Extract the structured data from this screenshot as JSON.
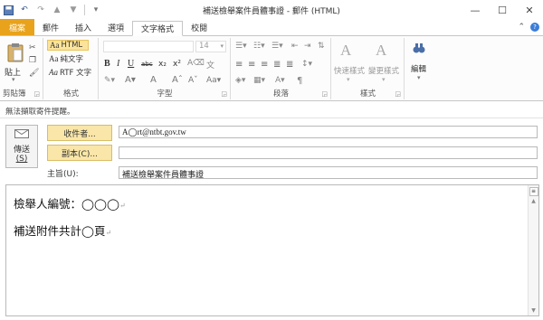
{
  "window": {
    "title": "補送檢舉案件員體事證 - 郵件 (HTML)"
  },
  "tabs": [
    {
      "label": "檔案"
    },
    {
      "label": "郵件"
    },
    {
      "label": "插入"
    },
    {
      "label": "選項"
    },
    {
      "label": "文字格式"
    },
    {
      "label": "校閱"
    }
  ],
  "ribbon": {
    "clipboard": {
      "paste": "貼上",
      "label": "剪貼簿"
    },
    "format": {
      "html": "HTML",
      "plain": "純文字",
      "rtf": "RTF 文字",
      "label": "格式"
    },
    "font": {
      "size": "14",
      "label": "字型"
    },
    "paragraph": {
      "label": "段落"
    },
    "styles": {
      "quick": "快速樣式",
      "change": "變更樣式",
      "label": "樣式"
    },
    "editing": {
      "label": "編輯"
    }
  },
  "infobar": {
    "text": "無法擷取寄件提醒。"
  },
  "compose": {
    "send": "傳送",
    "send_key": "(S)",
    "to_button": "收件者...",
    "cc_button": "副本(C)...",
    "subject_label": "主旨(U):",
    "to_value": "A◯rt@ntbt.gov.tw",
    "cc_value": "",
    "subject_value": "補送檢舉案件員體事證"
  },
  "body": {
    "line1": "檢舉人編號：◯◯◯",
    "line2": "補送附件共計◯頁"
  }
}
